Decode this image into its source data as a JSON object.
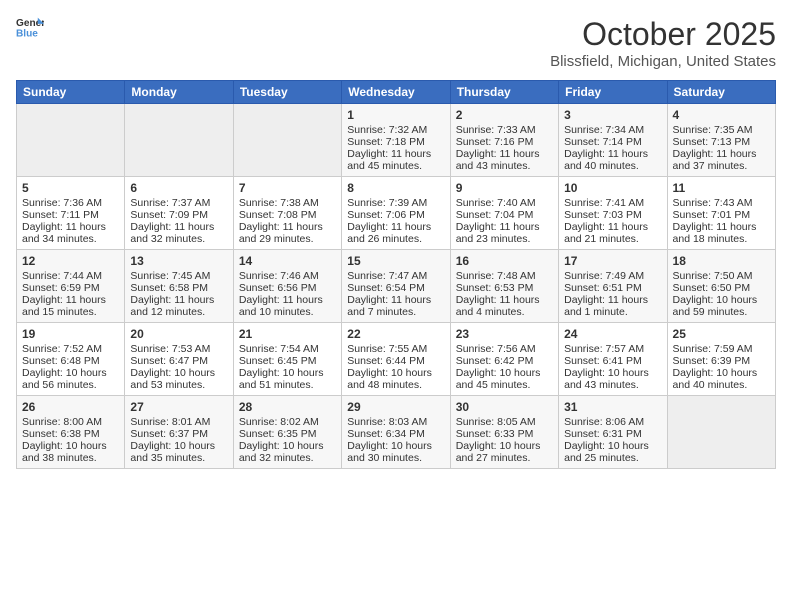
{
  "logo": {
    "general": "General",
    "blue": "Blue"
  },
  "header": {
    "month": "October 2025",
    "location": "Blissfield, Michigan, United States"
  },
  "weekdays": [
    "Sunday",
    "Monday",
    "Tuesday",
    "Wednesday",
    "Thursday",
    "Friday",
    "Saturday"
  ],
  "weeks": [
    [
      {
        "day": "",
        "empty": true
      },
      {
        "day": "",
        "empty": true
      },
      {
        "day": "",
        "empty": true
      },
      {
        "day": "1",
        "sunrise": "7:32 AM",
        "sunset": "7:18 PM",
        "daylight": "11 hours and 45 minutes."
      },
      {
        "day": "2",
        "sunrise": "7:33 AM",
        "sunset": "7:16 PM",
        "daylight": "11 hours and 43 minutes."
      },
      {
        "day": "3",
        "sunrise": "7:34 AM",
        "sunset": "7:14 PM",
        "daylight": "11 hours and 40 minutes."
      },
      {
        "day": "4",
        "sunrise": "7:35 AM",
        "sunset": "7:13 PM",
        "daylight": "11 hours and 37 minutes."
      }
    ],
    [
      {
        "day": "5",
        "sunrise": "7:36 AM",
        "sunset": "7:11 PM",
        "daylight": "11 hours and 34 minutes."
      },
      {
        "day": "6",
        "sunrise": "7:37 AM",
        "sunset": "7:09 PM",
        "daylight": "11 hours and 32 minutes."
      },
      {
        "day": "7",
        "sunrise": "7:38 AM",
        "sunset": "7:08 PM",
        "daylight": "11 hours and 29 minutes."
      },
      {
        "day": "8",
        "sunrise": "7:39 AM",
        "sunset": "7:06 PM",
        "daylight": "11 hours and 26 minutes."
      },
      {
        "day": "9",
        "sunrise": "7:40 AM",
        "sunset": "7:04 PM",
        "daylight": "11 hours and 23 minutes."
      },
      {
        "day": "10",
        "sunrise": "7:41 AM",
        "sunset": "7:03 PM",
        "daylight": "11 hours and 21 minutes."
      },
      {
        "day": "11",
        "sunrise": "7:43 AM",
        "sunset": "7:01 PM",
        "daylight": "11 hours and 18 minutes."
      }
    ],
    [
      {
        "day": "12",
        "sunrise": "7:44 AM",
        "sunset": "6:59 PM",
        "daylight": "11 hours and 15 minutes."
      },
      {
        "day": "13",
        "sunrise": "7:45 AM",
        "sunset": "6:58 PM",
        "daylight": "11 hours and 12 minutes."
      },
      {
        "day": "14",
        "sunrise": "7:46 AM",
        "sunset": "6:56 PM",
        "daylight": "11 hours and 10 minutes."
      },
      {
        "day": "15",
        "sunrise": "7:47 AM",
        "sunset": "6:54 PM",
        "daylight": "11 hours and 7 minutes."
      },
      {
        "day": "16",
        "sunrise": "7:48 AM",
        "sunset": "6:53 PM",
        "daylight": "11 hours and 4 minutes."
      },
      {
        "day": "17",
        "sunrise": "7:49 AM",
        "sunset": "6:51 PM",
        "daylight": "11 hours and 1 minute."
      },
      {
        "day": "18",
        "sunrise": "7:50 AM",
        "sunset": "6:50 PM",
        "daylight": "10 hours and 59 minutes."
      }
    ],
    [
      {
        "day": "19",
        "sunrise": "7:52 AM",
        "sunset": "6:48 PM",
        "daylight": "10 hours and 56 minutes."
      },
      {
        "day": "20",
        "sunrise": "7:53 AM",
        "sunset": "6:47 PM",
        "daylight": "10 hours and 53 minutes."
      },
      {
        "day": "21",
        "sunrise": "7:54 AM",
        "sunset": "6:45 PM",
        "daylight": "10 hours and 51 minutes."
      },
      {
        "day": "22",
        "sunrise": "7:55 AM",
        "sunset": "6:44 PM",
        "daylight": "10 hours and 48 minutes."
      },
      {
        "day": "23",
        "sunrise": "7:56 AM",
        "sunset": "6:42 PM",
        "daylight": "10 hours and 45 minutes."
      },
      {
        "day": "24",
        "sunrise": "7:57 AM",
        "sunset": "6:41 PM",
        "daylight": "10 hours and 43 minutes."
      },
      {
        "day": "25",
        "sunrise": "7:59 AM",
        "sunset": "6:39 PM",
        "daylight": "10 hours and 40 minutes."
      }
    ],
    [
      {
        "day": "26",
        "sunrise": "8:00 AM",
        "sunset": "6:38 PM",
        "daylight": "10 hours and 38 minutes."
      },
      {
        "day": "27",
        "sunrise": "8:01 AM",
        "sunset": "6:37 PM",
        "daylight": "10 hours and 35 minutes."
      },
      {
        "day": "28",
        "sunrise": "8:02 AM",
        "sunset": "6:35 PM",
        "daylight": "10 hours and 32 minutes."
      },
      {
        "day": "29",
        "sunrise": "8:03 AM",
        "sunset": "6:34 PM",
        "daylight": "10 hours and 30 minutes."
      },
      {
        "day": "30",
        "sunrise": "8:05 AM",
        "sunset": "6:33 PM",
        "daylight": "10 hours and 27 minutes."
      },
      {
        "day": "31",
        "sunrise": "8:06 AM",
        "sunset": "6:31 PM",
        "daylight": "10 hours and 25 minutes."
      },
      {
        "day": "",
        "empty": true
      }
    ]
  ],
  "labels": {
    "sunrise": "Sunrise:",
    "sunset": "Sunset:",
    "daylight": "Daylight:"
  }
}
